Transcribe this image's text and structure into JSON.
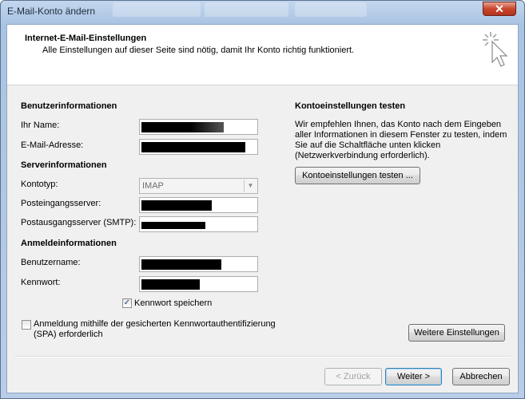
{
  "window": {
    "title": "E-Mail-Konto ändern",
    "close_glyph": "✕"
  },
  "header": {
    "title": "Internet-E-Mail-Einstellungen",
    "subtitle": "Alle Einstellungen auf dieser Seite sind nötig, damit Ihr Konto richtig funktioniert.",
    "icon": "sparkle-cursor-icon"
  },
  "user_info": {
    "heading": "Benutzerinformationen",
    "name_label": "Ihr Name:",
    "email_label": "E-Mail-Adresse:"
  },
  "server_info": {
    "heading": "Serverinformationen",
    "account_type_label": "Kontotyp:",
    "account_type_value": "IMAP",
    "incoming_label": "Posteingangsserver:",
    "outgoing_label": "Postausgangsserver (SMTP):"
  },
  "login_info": {
    "heading": "Anmeldeinformationen",
    "username_label": "Benutzername:",
    "password_label": "Kennwort:",
    "save_password_label": "Kennwort speichern",
    "save_password_checked": true,
    "spa_label_line1": "Anmeldung mithilfe der gesicherten Kennwortauthentifizierung",
    "spa_label_line2": "(SPA) erforderlich",
    "spa_checked": false
  },
  "test": {
    "heading": "Kontoeinstellungen testen",
    "description": "Wir empfehlen Ihnen, das Konto nach dem Eingeben aller Informationen in diesem Fenster zu testen, indem Sie auf die Schaltfläche unten klicken (Netzwerkverbindung erforderlich).",
    "button": "Kontoeinstellungen testen ..."
  },
  "buttons": {
    "more_settings": "Weitere Einstellungen",
    "back": "< Zurück",
    "next": "Weiter >",
    "cancel": "Abbrechen"
  },
  "check_glyph": "✓"
}
